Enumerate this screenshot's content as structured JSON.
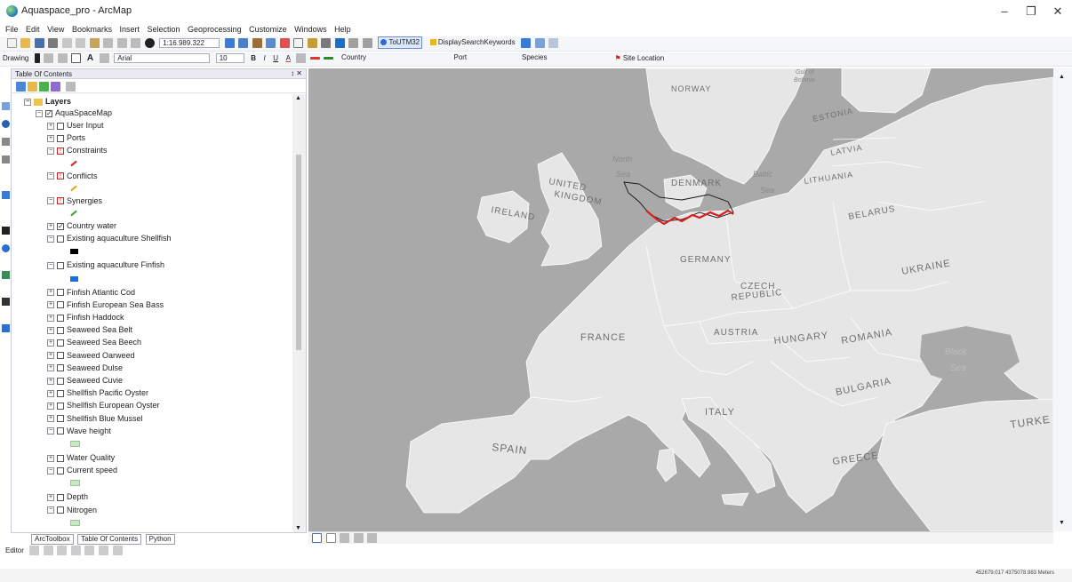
{
  "window": {
    "title": "Aquaspace_pro - ArcMap",
    "controls": [
      "–",
      "❐",
      "✕"
    ]
  },
  "menu": [
    "File",
    "Edit",
    "View",
    "Bookmarks",
    "Insert",
    "Selection",
    "Geoprocessing",
    "Customize",
    "Windows",
    "Help"
  ],
  "toolbar1": {
    "scale": "1:16.989.322",
    "button_utm": "ToUTM32",
    "button_search": "DisplaySearchKeywords"
  },
  "toolbar2": {
    "drawing_label": "Drawing",
    "font_name": "Arial",
    "font_size": "10",
    "bold": "B",
    "italic": "I",
    "underline": "U",
    "text_a": "A",
    "dropdown_country": "Country",
    "dropdown_port": "Port",
    "dropdown_species": "Species",
    "site_location": "Site Location"
  },
  "toc": {
    "title": "Table Of Contents",
    "pin": "↕ ✕",
    "layers_root": "Layers",
    "map_name": "AquaSpaceMap",
    "items": [
      {
        "label": "User Input",
        "toggle": "+",
        "checked": false,
        "warn": false
      },
      {
        "label": "Ports",
        "toggle": "+",
        "checked": false,
        "warn": false
      },
      {
        "label": "Constraints",
        "toggle": "−",
        "checked": false,
        "warn": true
      },
      {
        "label": "Conflicts",
        "toggle": "−",
        "checked": false,
        "warn": true
      },
      {
        "label": "Synergies",
        "toggle": "−",
        "checked": false,
        "warn": true
      },
      {
        "label": "Country water",
        "toggle": "+",
        "checked": true,
        "warn": false
      },
      {
        "label": "Existing aquaculture Shellfish",
        "toggle": "−",
        "checked": false,
        "warn": false
      },
      {
        "label": "Existing aquaculture Finfish",
        "toggle": "−",
        "checked": false,
        "warn": false
      },
      {
        "label": "Finfish Atlantic Cod",
        "toggle": "+",
        "checked": false,
        "warn": false
      },
      {
        "label": "Finfish European Sea Bass",
        "toggle": "+",
        "checked": false,
        "warn": false
      },
      {
        "label": "Finfish Haddock",
        "toggle": "+",
        "checked": false,
        "warn": false
      },
      {
        "label": "Seaweed Sea Belt",
        "toggle": "+",
        "checked": false,
        "warn": false
      },
      {
        "label": "Seaweed Sea Beech",
        "toggle": "+",
        "checked": false,
        "warn": false
      },
      {
        "label": "Seaweed Oarweed",
        "toggle": "+",
        "checked": false,
        "warn": false
      },
      {
        "label": "Seaweed Dulse",
        "toggle": "+",
        "checked": false,
        "warn": false
      },
      {
        "label": "Seaweed Cuvie",
        "toggle": "+",
        "checked": false,
        "warn": false
      },
      {
        "label": "Shellfish Pacific Oyster",
        "toggle": "+",
        "checked": false,
        "warn": false
      },
      {
        "label": "Shellfish European Oyster",
        "toggle": "+",
        "checked": false,
        "warn": false
      },
      {
        "label": "Shellfish Blue Mussel",
        "toggle": "+",
        "checked": false,
        "warn": false
      },
      {
        "label": "Wave height",
        "toggle": "−",
        "checked": false,
        "warn": false
      },
      {
        "label": "Water Quality",
        "toggle": "+",
        "checked": false,
        "warn": false
      },
      {
        "label": "Current speed",
        "toggle": "−",
        "checked": false,
        "warn": false
      },
      {
        "label": "Depth",
        "toggle": "+",
        "checked": false,
        "warn": false
      },
      {
        "label": "Nitrogen",
        "toggle": "−",
        "checked": false,
        "warn": false
      }
    ],
    "colors": {
      "constraints": "#d62020",
      "conflicts": "#e8a020",
      "synergies": "#3aa03a",
      "shellfish": "#000000",
      "finfish": "#1a6fe0",
      "raster": "#c9e8c0"
    }
  },
  "bottom_tabs": [
    "ArcToolbox",
    "Table Of Contents",
    "Python"
  ],
  "editor": {
    "label": "Editor"
  },
  "map": {
    "land_color": "#e6e6e6",
    "sea_color": "#a9a9a9",
    "boundary_color": "#ffffff",
    "labels": {
      "norway": "NORWAY",
      "estonia": "ESTONIA",
      "latvia": "LATVIA",
      "lithuania": "LITHUANIA",
      "denmark": "DENMARK",
      "united": "UNITED",
      "kingdom": "KINGDOM",
      "ireland": "IRELAND",
      "belarus": "BELARUS",
      "germany": "GERMANY",
      "czech": "CZECH",
      "republic": "REPUBLIC",
      "ukraine": "UKRAINE",
      "france": "FRANCE",
      "austria": "AUSTRIA",
      "hungary": "HUNGARY",
      "romania": "ROMANIA",
      "bulgaria": "BULGARIA",
      "italy": "ITALY",
      "spain": "SPAIN",
      "greece": "GREECE",
      "turkey": "TURKE",
      "north": "North",
      "sea1": "Sea",
      "baltic": "Baltic",
      "sea2": "Sea",
      "black": "Black",
      "sea3": "Sea",
      "gulf1": "Gulf of",
      "gulf2": "Bothnia"
    }
  },
  "status": {
    "coords": "452679.017  4375078.983 Meters"
  }
}
